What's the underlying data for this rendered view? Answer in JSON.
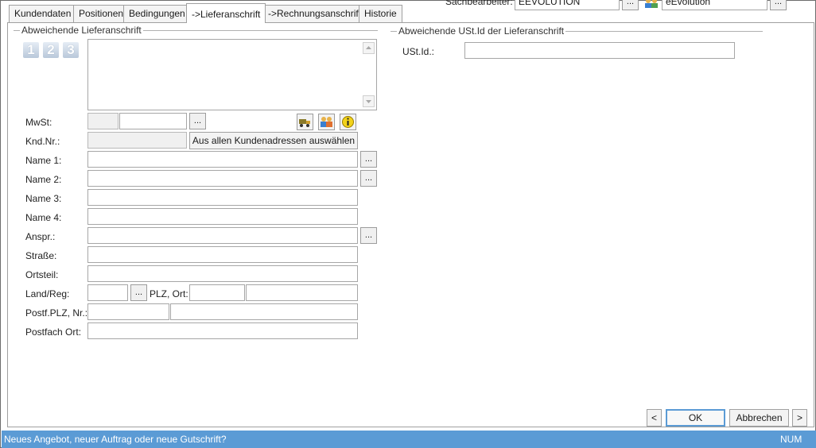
{
  "header": {
    "sachbearbeiter_label": "Sachbearbeiter:",
    "sachbearbeiter_code": "EEVOLUTION",
    "sachbearbeiter_name": "eEvolution",
    "more_label": "..."
  },
  "tabs": [
    {
      "label": "Kundendaten"
    },
    {
      "label": "Positionen"
    },
    {
      "label": "Bedingungen"
    },
    {
      "label": "->Lieferanschrift"
    },
    {
      "label": "->Rechnungsanschrift"
    },
    {
      "label": "Historie"
    }
  ],
  "left_group": {
    "title": "Abweichende Lieferanschrift",
    "address_slots": [
      "1",
      "2",
      "3"
    ],
    "address_text": "",
    "mwst_label": "MwSt:",
    "mwst_code": "",
    "mwst_value": "",
    "kndnr_label": "Knd.Nr.:",
    "kndnr_value": "",
    "select_all_label": "Aus allen Kundenadressen auswählen",
    "fields": {
      "name1_label": "Name 1:",
      "name2_label": "Name 2:",
      "name3_label": "Name 3:",
      "name4_label": "Name 4:",
      "anspr_label": "Anspr.:",
      "strasse_label": "Straße:",
      "ortsteil_label": "Ortsteil:",
      "land_label": "Land/Reg:",
      "plz_ort_label": "PLZ, Ort:",
      "postf_label": "Postf.PLZ, Nr.:",
      "postfach_ort_label": "Postfach Ort:"
    },
    "more_label": "..."
  },
  "right_group": {
    "title": "Abweichende USt.Id der Lieferanschrift",
    "ustid_label": "USt.Id.:",
    "ustid_value": ""
  },
  "footer": {
    "prev_label": "<",
    "ok_label": "OK",
    "cancel_label": "Abbrechen",
    "next_label": ">"
  },
  "statusbar": {
    "message": "Neues Angebot, neuer Auftrag oder neue Gutschrift?",
    "num": "NUM"
  },
  "icons": {
    "truck": "truck-icon",
    "people": "people-icon",
    "info": "info-icon"
  },
  "colors": {
    "statusbar": "#5b9bd5",
    "default_button_border": "#5b9bd5"
  }
}
